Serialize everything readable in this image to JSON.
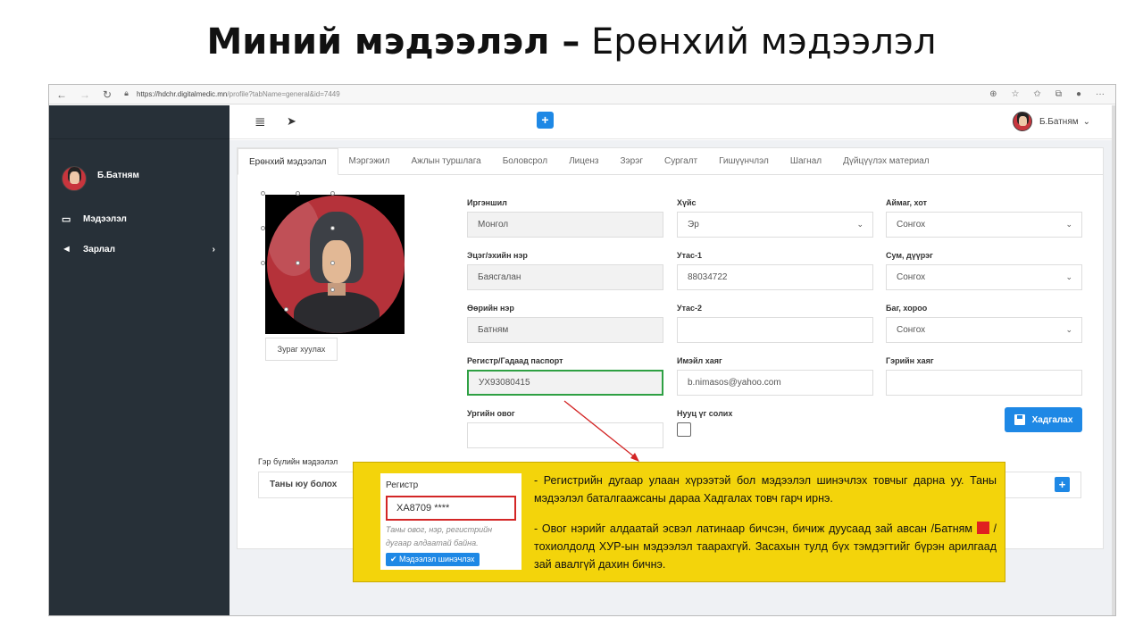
{
  "slide_title": {
    "bold": "Миний мэдээлэл –",
    "light": " Ерөнхий мэдээлэл"
  },
  "browser": {
    "url_host": "https://hdchr.digitalmedic.mn",
    "url_path": "/profile?tabName=general&id=7449"
  },
  "sidebar": {
    "user_name": "Б.Батням",
    "items": [
      {
        "label": "Мэдээлэл",
        "icon": "monitor-icon"
      },
      {
        "label": "Зарлал",
        "icon": "megaphone-icon"
      }
    ]
  },
  "topbar": {
    "user_name": "Б.Батням"
  },
  "tabs": [
    "Ерөнхий мэдээлэл",
    "Мэргэжил",
    "Ажлын туршлага",
    "Боловсрол",
    "Лиценз",
    "Зэрэг",
    "Сургалт",
    "Гишүүнчлэл",
    "Шагнал",
    "Дүйцүүлэх материал"
  ],
  "photo": {
    "upload_label": "Зураг хуулах"
  },
  "form": {
    "citizenship": {
      "label": "Иргэншил",
      "value": "Монгол"
    },
    "gender": {
      "label": "Хүйс",
      "value": "Эр"
    },
    "aimag": {
      "label": "Аймаг, хот",
      "value": "Сонгох"
    },
    "parent_name": {
      "label": "Эцэг/эхийн нэр",
      "value": "Баясгалан"
    },
    "phone1": {
      "label": "Утас-1",
      "value": "88034722"
    },
    "sum": {
      "label": "Сум, дүүрэг",
      "value": "Сонгох"
    },
    "own_name": {
      "label": "Өөрийн нэр",
      "value": "Батням"
    },
    "phone2": {
      "label": "Утас-2",
      "value": ""
    },
    "bag": {
      "label": "Баг, хороо",
      "value": "Сонгох"
    },
    "register": {
      "label": "Регистр/Гадаад паспорт",
      "value": "УХ93080415"
    },
    "email": {
      "label": "Имэйл хаяг",
      "value": "b.nimasos@yahoo.com"
    },
    "home_address": {
      "label": "Гэрийн хаяг",
      "value": ""
    },
    "family_name": {
      "label": "Ургийн овог",
      "value": ""
    },
    "change_password": {
      "label": "Нууц үг солих"
    },
    "save_label": "Хадгалах"
  },
  "family": {
    "section_label": "Гэр бүлийн мэдээлэл",
    "column": "Таны юу болох"
  },
  "note": {
    "inset_title": "Регистр",
    "inset_value": "ХА8709 ****",
    "inset_error": "Таны овог, нэр, регистрийн дугаар алдаатай байна.",
    "inset_button": "Мэдээлэл шинэчлэх",
    "para1": "- Регистрийн дугаар улаан хүрээтэй бол мэдээлэл шинэчлэх товчыг дарна уу. Таны мэдээлэл баталгаажсаны дараа Хадгалах товч гарч ирнэ.",
    "para2_a": "- Овог нэрийг алдаатай эсвэл латинаар бичсэн, бичиж дуусаад зай авсан /Батням",
    "para2_b": "/ тохиолдолд ХУР-ын мэдээлэл таарахгүй. Засахын тулд бүх тэмдэгтийг бүрэн арилгаад зай авалгүй дахин бичнэ."
  },
  "colors": {
    "primary": "#1e88e5",
    "sidebar": "#273038",
    "highlight_green": "#2ea043",
    "error_red": "#d32626",
    "note_yellow": "#f3d40b"
  }
}
